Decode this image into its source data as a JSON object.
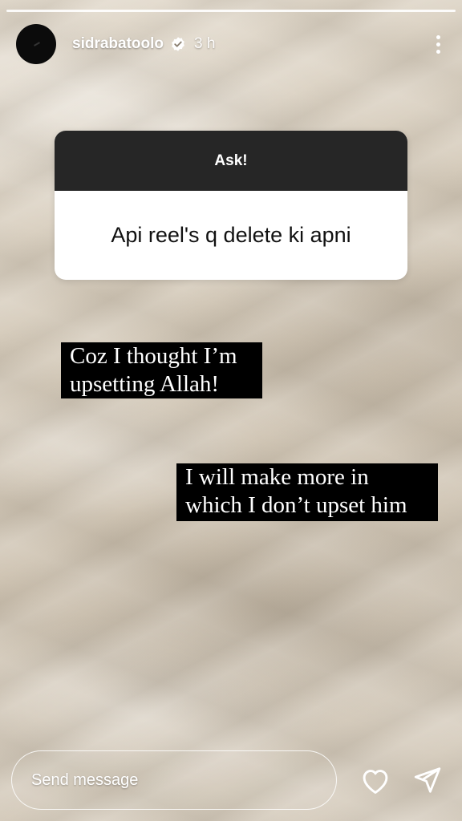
{
  "story": {
    "progress_segments": 1,
    "user": {
      "username": "sidrabatoolo",
      "time": "3 h",
      "verified": true
    },
    "question_sticker": {
      "header": "Ask!",
      "question": "Api reel's q delete ki apni"
    },
    "captions": [
      "Coz I thought I’m upsetting Allah!",
      "I will make more in which I don’t upset him"
    ]
  },
  "footer": {
    "message_placeholder": "Send message"
  },
  "icons": {
    "more": "more-vertical-icon",
    "verified": "verified-badge-icon",
    "like": "heart-icon",
    "share": "send-icon"
  },
  "colors": {
    "sticker_header_bg": "#262626",
    "sticker_body_bg": "#ffffff",
    "caption_bg": "#000000",
    "text_on_story": "#ffffff"
  }
}
